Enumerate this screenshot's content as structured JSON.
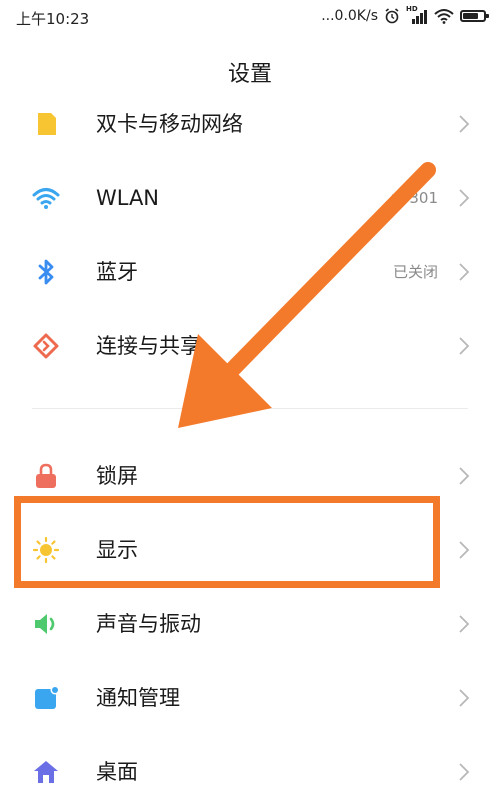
{
  "status_bar": {
    "time": "上午10:23",
    "net_speed": "...0.0K/s",
    "hd": "HD",
    "battery_level": 0.85
  },
  "page": {
    "title": "设置"
  },
  "items": [
    {
      "label": "双卡与移动网络",
      "value": "",
      "icon": "sim-card-icon"
    },
    {
      "label": "WLAN",
      "value": "r−301",
      "icon": "wifi-icon"
    },
    {
      "label": "蓝牙",
      "value": "已关闭",
      "icon": "bluetooth-icon"
    },
    {
      "label": "连接与共享",
      "value": "",
      "icon": "connection-share-icon"
    },
    {
      "label": "锁屏",
      "value": "",
      "icon": "lock-icon"
    },
    {
      "label": "显示",
      "value": "",
      "icon": "sun-icon"
    },
    {
      "label": "声音与振动",
      "value": "",
      "icon": "speaker-icon"
    },
    {
      "label": "通知管理",
      "value": "",
      "icon": "notification-icon"
    },
    {
      "label": "桌面",
      "value": "",
      "icon": "home-icon"
    }
  ],
  "colors": {
    "sim": "#f7c531",
    "wifi": "#3aa6f0",
    "bluetooth": "#3a8df0",
    "share": "#ee6a4e",
    "lock": "#ef6f5e",
    "sun": "#f7c531",
    "speaker": "#4fc96d",
    "notify": "#3aa6f0",
    "home": "#6b6fe6",
    "annotation": "#f47a2b"
  }
}
